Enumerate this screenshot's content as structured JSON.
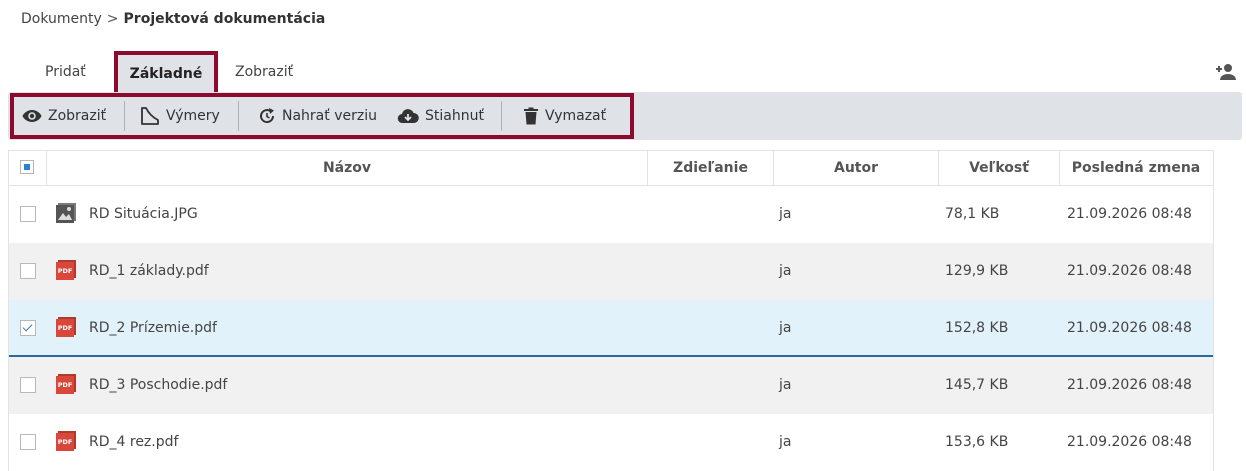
{
  "breadcrumb": {
    "root": "Dokumenty",
    "separator": ">",
    "current": "Projektová dokumentácia"
  },
  "tabs": [
    {
      "label": "Pridať"
    },
    {
      "label": "Základné",
      "active": true
    },
    {
      "label": "Zobraziť"
    }
  ],
  "header_actions": {
    "add_user_icon": "person-add-icon"
  },
  "toolbar": {
    "buttons": [
      {
        "label": "Zobraziť",
        "icon": "eye-icon"
      },
      {
        "label": "Výmery",
        "icon": "measure-icon"
      },
      {
        "label": "Nahrať verziu",
        "icon": "refresh-icon"
      },
      {
        "label": "Stiahnuť",
        "icon": "cloud-download-icon"
      },
      {
        "label": "Vymazať",
        "icon": "trash-icon"
      }
    ]
  },
  "table": {
    "columns": [
      "Názov",
      "Zdieľanie",
      "Autor",
      "Veľkosť",
      "Posledná zmena"
    ],
    "header_checkbox": "indeterminate",
    "rows": [
      {
        "name": "RD Situácia.JPG",
        "type": "image",
        "sharing": "",
        "author": "ja",
        "size": "78,1 KB",
        "modified": "21.09.2026 08:48",
        "checked": false
      },
      {
        "name": "RD_1 základy.pdf",
        "type": "pdf",
        "sharing": "",
        "author": "ja",
        "size": "129,9 KB",
        "modified": "21.09.2026 08:48",
        "checked": false
      },
      {
        "name": "RD_2 Prízemie.pdf",
        "type": "pdf",
        "sharing": "",
        "author": "ja",
        "size": "152,8 KB",
        "modified": "21.09.2026 08:48",
        "checked": true
      },
      {
        "name": "RD_3 Poschodie.pdf",
        "type": "pdf",
        "sharing": "",
        "author": "ja",
        "size": "145,7 KB",
        "modified": "21.09.2026 08:48",
        "checked": false
      },
      {
        "name": "RD_4 rez.pdf",
        "type": "pdf",
        "sharing": "",
        "author": "ja",
        "size": "153,6 KB",
        "modified": "21.09.2026 08:48",
        "checked": false
      }
    ]
  },
  "colors": {
    "highlight_frame": "#8b0a2e",
    "toolbar_bg": "#dfe3e8",
    "selected_row_bg": "#e2f2fa",
    "pdf_red": "#d9473b"
  }
}
